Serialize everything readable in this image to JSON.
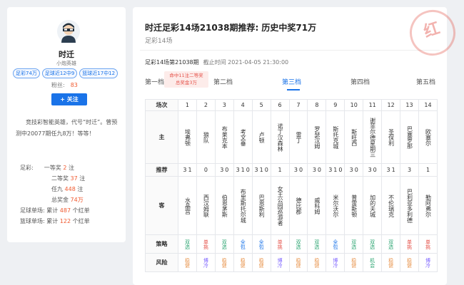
{
  "profile": {
    "name": "时迁",
    "subtitle": "小炮英雄",
    "badges": [
      "足彩74万",
      "足球近12中9",
      "篮球近17中12"
    ],
    "fans_label": "粉丝:",
    "fans_count": "83",
    "follow_label": "+ 关注",
    "intro": "竞技彩智能英雄，代号“时迁”。曾预测中20077期任九8万！等等！",
    "stats": {
      "football_lottery_label": "足彩:",
      "first_prize_label": "一等奖",
      "first_prize_count": "2",
      "second_prize_label": "二等奖",
      "second_prize_count": "37",
      "renjiu_label": "任九",
      "renjiu_count": "448",
      "unit_zhu": "注",
      "total_prize_label": "总奖金",
      "total_prize_value": "74万",
      "football_single_label": "足球单场:",
      "football_single_text": "累计",
      "football_single_count": "487",
      "basketball_single_label": "篮球单场:",
      "basketball_single_text": "累计",
      "basketball_single_count": "122",
      "unit_hongdan": "个红单"
    }
  },
  "article": {
    "title": "时迁足彩14场21038期推荐: 历史中奖71万",
    "subtitle": "足彩14场",
    "issue_label": "足彩14场第21038期",
    "deadline": "截止时间 2021-04-05 21:30:00",
    "stamp": "红"
  },
  "tabs": [
    {
      "label": "第一档"
    },
    {
      "label": "第二档"
    },
    {
      "label": "第三档"
    },
    {
      "label": "第四档"
    },
    {
      "label": "第五档"
    }
  ],
  "tip": {
    "line1": "命中11注二等奖",
    "line2": "总奖金3万"
  },
  "table": {
    "row_labels": {
      "match": "场次",
      "home": "主",
      "recommend": "推荐",
      "away": "客",
      "strategy": "策略",
      "risk": "风险"
    },
    "matches": [
      {
        "no": "1",
        "home": "埃弗顿",
        "rec": [
          "3",
          "1"
        ],
        "away": "水晶宫",
        "strategy": "双选",
        "strategy_color": "green",
        "risk": "稳健",
        "risk_color": "orange"
      },
      {
        "no": "2",
        "home": "狼队",
        "rec": [
          "0"
        ],
        "away": "西汉姆联",
        "strategy": "单挑",
        "strategy_color": "red",
        "risk": "博冷",
        "risk_color": "purple"
      },
      {
        "no": "3",
        "home": "布莱克本",
        "rec": [
          "3",
          "0"
        ],
        "away": "伯恩茅斯",
        "strategy": "双选",
        "strategy_color": "green",
        "risk": "稳健",
        "risk_color": "orange"
      },
      {
        "no": "4",
        "home": "考文垂",
        "rec": [
          "3",
          "1",
          "0"
        ],
        "away": "布里斯托尔城",
        "strategy": "全包",
        "strategy_color": "blue",
        "risk": "稳健",
        "risk_color": "orange"
      },
      {
        "no": "5",
        "home": "卢顿",
        "rec": [
          "3",
          "1",
          "0"
        ],
        "away": "巴恩斯利",
        "strategy": "全包",
        "strategy_color": "blue",
        "risk": "稳健",
        "risk_color": "orange"
      },
      {
        "no": "6",
        "home": "诺丁汉森林",
        "rec": [
          "1"
        ],
        "away": "女王公园巡游者",
        "strategy": "单挑",
        "strategy_color": "red",
        "risk": "博冷",
        "risk_color": "purple"
      },
      {
        "no": "7",
        "home": "雷丁",
        "rec": [
          "3",
          "0"
        ],
        "away": "德比郡",
        "strategy": "双选",
        "strategy_color": "green",
        "risk": "稳健",
        "risk_color": "orange"
      },
      {
        "no": "8",
        "home": "罗瑟汉姆",
        "rec": [
          "3",
          "0"
        ],
        "away": "威科姆",
        "strategy": "双选",
        "strategy_color": "green",
        "risk": "稳健",
        "risk_color": "orange"
      },
      {
        "no": "9",
        "home": "斯托克城",
        "rec": [
          "3",
          "1",
          "0"
        ],
        "away": "米尔沃尔",
        "strategy": "全包",
        "strategy_color": "blue",
        "risk": "博冷",
        "risk_color": "purple"
      },
      {
        "no": "10",
        "home": "斯旺西",
        "rec": [
          "3",
          "0"
        ],
        "away": "普雷斯顿",
        "strategy": "双选",
        "strategy_color": "green",
        "risk": "稳健",
        "risk_color": "orange"
      },
      {
        "no": "11",
        "home": "谢菲尔德星期三",
        "rec": [
          "3",
          "0"
        ],
        "away": "加的夫城",
        "strategy": "双选",
        "strategy_color": "green",
        "risk": "机会",
        "risk_color": "green"
      },
      {
        "no": "12",
        "home": "圣保利",
        "rec": [
          "3",
          "1"
        ],
        "away": "不伦瑞克",
        "strategy": "双选",
        "strategy_color": "green",
        "risk": "稳健",
        "risk_color": "orange"
      },
      {
        "no": "13",
        "home": "巴塞罗那",
        "rec": [
          "3"
        ],
        "away": "巴利亚多利德",
        "strategy": "单挑",
        "strategy_color": "red",
        "risk": "稳健",
        "risk_color": "orange"
      },
      {
        "no": "14",
        "home": "欧塞尔",
        "rec": [
          "1"
        ],
        "away": "勒阿弗尔",
        "strategy": "单挑",
        "strategy_color": "red",
        "risk": "博冷",
        "risk_color": "purple"
      }
    ]
  }
}
